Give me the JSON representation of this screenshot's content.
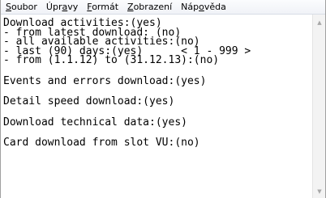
{
  "menu": {
    "items": [
      {
        "mnemonic": "S",
        "rest": "oubor"
      },
      {
        "pre": "Úpr",
        "mnemonic": "a",
        "rest": "vy"
      },
      {
        "mnemonic": "F",
        "rest": "ormát"
      },
      {
        "mnemonic": "Z",
        "rest": "obrazení"
      },
      {
        "pre": "Náp",
        "mnemonic": "o",
        "rest": "věda"
      }
    ]
  },
  "editor": {
    "lines": [
      "Download activities:(yes)",
      "- from latest download: (no)",
      "- all available activities:(no)",
      "- last (90) days:(yes)      < 1 - 999 >",
      "- from (1.1.12) to (31.12.13):(no)",
      "Events and errors download:(yes)",
      "Detail speed download:(yes)",
      "Download technical data:(yes)",
      "Card download from slot VU:(no)"
    ]
  },
  "scrollbar": {
    "up_icon": "▲",
    "down_icon": "▼"
  }
}
